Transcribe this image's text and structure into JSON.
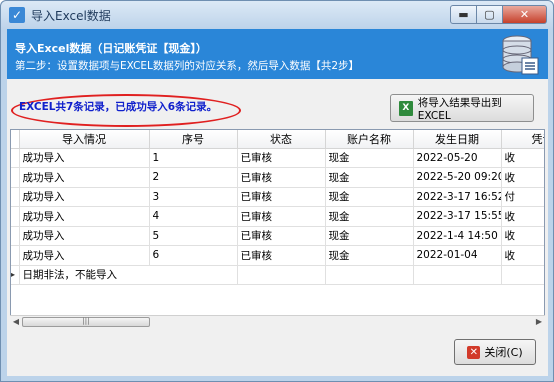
{
  "window": {
    "title": "导入Excel数据",
    "min_label": "▬",
    "max_label": "▢",
    "close_label": "✕"
  },
  "header": {
    "title": "导入Excel数据（日记账凭证【现金】）",
    "subtitle": "第二步：设置数据项与EXCEL数据列的对应关系，然后导入数据【共2步】"
  },
  "result": {
    "message": "EXCEL共7条记录，已成功导入6条记录。"
  },
  "export_button": {
    "label": "将导入结果导出到EXCEL"
  },
  "table": {
    "columns": [
      "导入情况",
      "序号",
      "状态",
      "账户名称",
      "发生日期",
      "凭证"
    ],
    "rows": [
      {
        "status": "成功导入",
        "no": "1",
        "state": "已审核",
        "account": "现金",
        "date": "2022-05-20",
        "voucher": "收"
      },
      {
        "status": "成功导入",
        "no": "2",
        "state": "已审核",
        "account": "现金",
        "date": "2022-5-20 09:20",
        "voucher": "收"
      },
      {
        "status": "成功导入",
        "no": "3",
        "state": "已审核",
        "account": "现金",
        "date": "2022-3-17 16:52",
        "voucher": "付"
      },
      {
        "status": "成功导入",
        "no": "4",
        "state": "已审核",
        "account": "现金",
        "date": "2022-3-17 15:55",
        "voucher": "收"
      },
      {
        "status": "成功导入",
        "no": "5",
        "state": "已审核",
        "account": "现金",
        "date": "2022-1-4 14:50",
        "voucher": "收"
      },
      {
        "status": "成功导入",
        "no": "6",
        "state": "已审核",
        "account": "现金",
        "date": "2022-01-04",
        "voucher": "收"
      },
      {
        "status": "日期非法，不能导入",
        "no": "",
        "state": "",
        "account": "",
        "date": "",
        "voucher": ""
      }
    ]
  },
  "scrollbar": {
    "left_arrow": "◀",
    "right_arrow": "▶",
    "thumb_grip": "|||"
  },
  "close_button": {
    "label": "关闭(C)"
  },
  "colors": {
    "header_bg": "#2a86d8",
    "ellipse": "#e02020",
    "result_text": "#1020cc"
  }
}
